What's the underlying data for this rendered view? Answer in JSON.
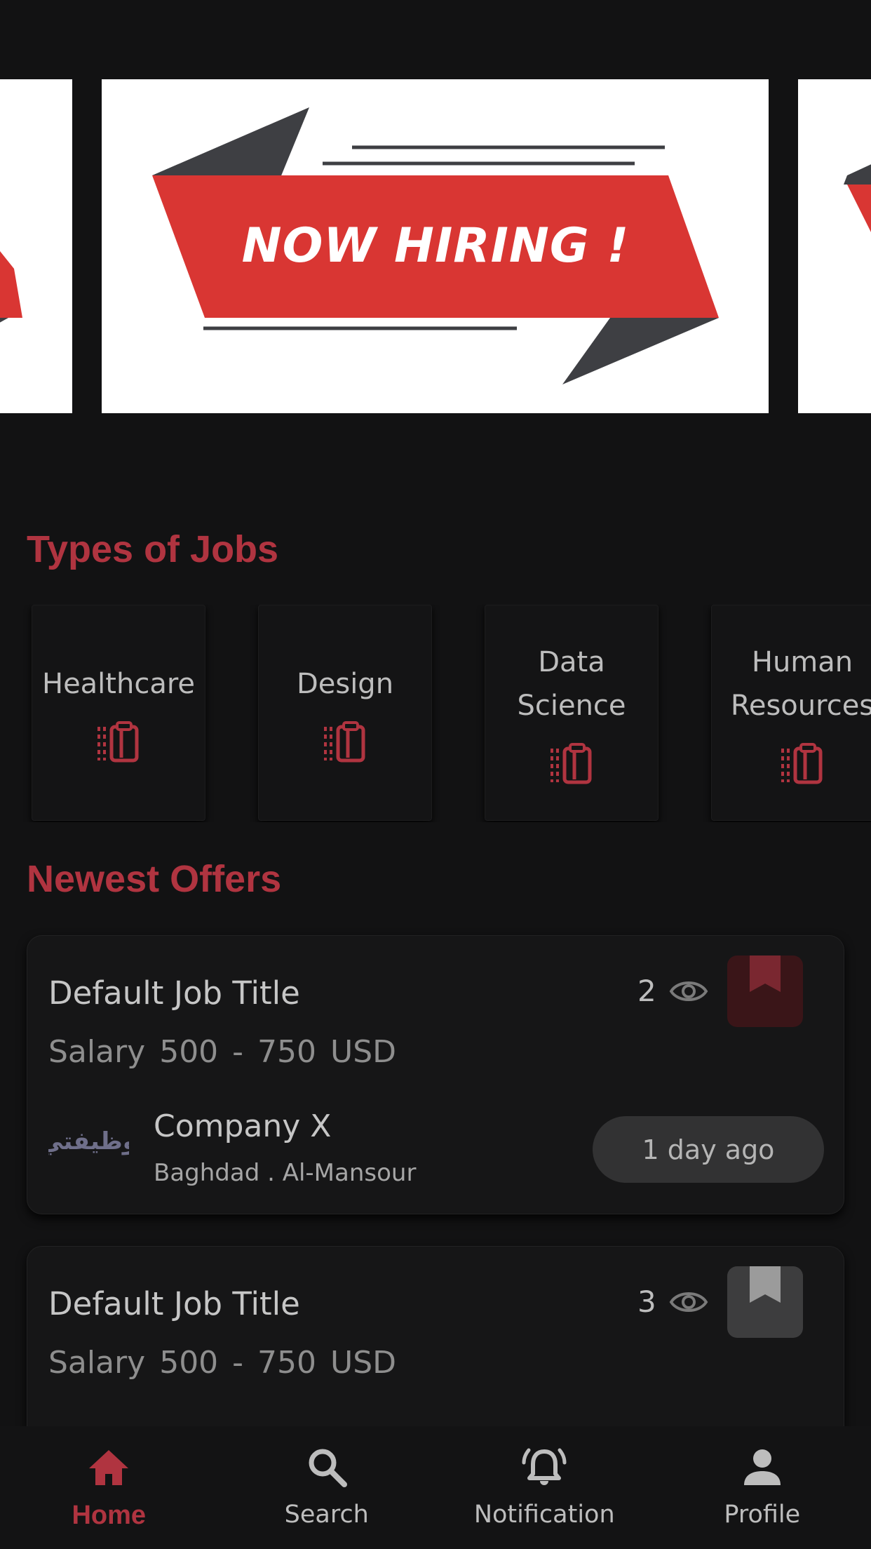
{
  "banner": {
    "slides": [
      {
        "text": "NOW HIRING !"
      }
    ]
  },
  "sections": {
    "types_title": "Types of Jobs",
    "offers_title": "Newest Offers"
  },
  "categories": [
    {
      "label": "Healthcare",
      "icon": "clipboard-icon"
    },
    {
      "label": "Design",
      "icon": "clipboard-icon"
    },
    {
      "label": "Data\nScience",
      "icon": "clipboard-icon"
    },
    {
      "label": "Human\nResources",
      "icon": "clipboard-icon"
    }
  ],
  "jobs": [
    {
      "title": "Default Job Title",
      "salary": "Salary  500 - 750  USD",
      "views": "2",
      "bookmarked": true,
      "company": "Company X",
      "location": "Baghdad . Al-Mansour",
      "posted": "1 day ago",
      "logo_text": "وظيفتي"
    },
    {
      "title": "Default Job Title",
      "salary": "Salary  500 - 750  USD",
      "views": "3",
      "bookmarked": false
    }
  ],
  "nav": {
    "home": "Home",
    "search": "Search",
    "notification": "Notification",
    "profile": "Profile",
    "active": "home"
  },
  "colors": {
    "accent": "#b03440",
    "background": "#121213",
    "card": "#161617",
    "banner_red": "#d93633",
    "banner_dark": "#3e3f43"
  }
}
